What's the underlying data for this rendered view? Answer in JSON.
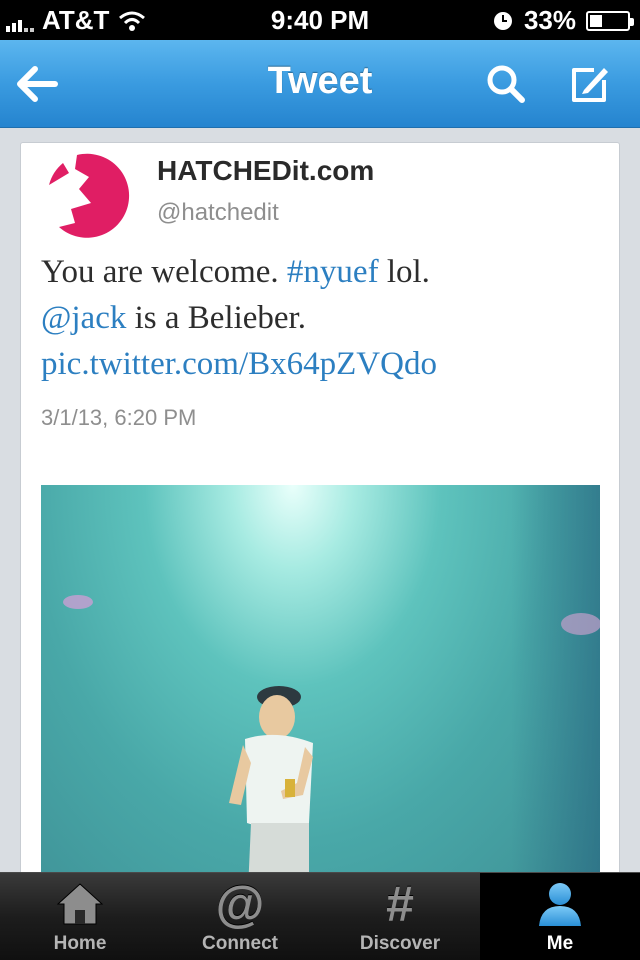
{
  "status_bar": {
    "carrier": "AT&T",
    "time": "9:40 PM",
    "battery_percent": "33%",
    "battery_level": 0.33
  },
  "nav": {
    "title": "Tweet",
    "back_icon": "back-arrow-icon",
    "search_icon": "search-icon",
    "compose_icon": "compose-icon",
    "accent": "#3a9be0"
  },
  "tweet": {
    "author_name": "HATCHEDit.com",
    "handle": "@hatchedit",
    "text_part1": "You are welcome. ",
    "hashtag": "#nyuef",
    "text_part2": " lol.",
    "mention": "@jack",
    "text_part3": " is a Belieber.",
    "link": "pic.twitter.com/Bx64pZVQdo",
    "timestamp": "3/1/13, 6:20 PM",
    "link_color": "#2c7fc1"
  },
  "tabs": [
    {
      "label": "Home",
      "icon": "home-icon"
    },
    {
      "label": "Connect",
      "icon": "at-icon"
    },
    {
      "label": "Discover",
      "icon": "hashtag-icon"
    },
    {
      "label": "Me",
      "icon": "person-icon",
      "active": true
    }
  ]
}
